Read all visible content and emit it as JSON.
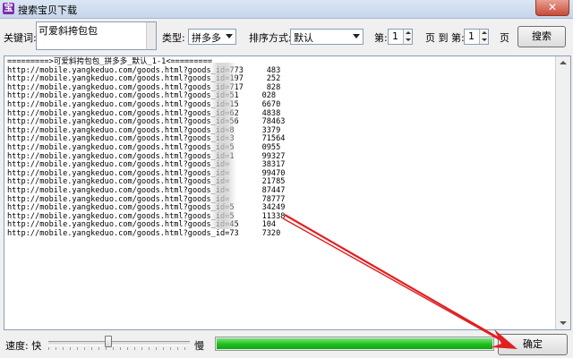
{
  "window": {
    "title": "搜索宝贝下载",
    "app_icon_glyph": "宝"
  },
  "search": {
    "keyword_label": "关键词:",
    "keyword_value": "可爱斜挎包包",
    "type_label": "类型:",
    "type_value": "拼多多",
    "sort_label": "排序方式:",
    "sort_value": "默认",
    "page_prefix": "第:",
    "page_from": "1",
    "page_middle": "页 到 第:",
    "page_to": "1",
    "page_suffix": "页",
    "search_button": "搜索"
  },
  "results": {
    "lines": [
      "=========>可爱斜挎包包_拼多多_默认_1-1<=========",
      "http://mobile.yangkeduo.com/goods.html?goods_id=773     483",
      "http://mobile.yangkeduo.com/goods.html?goods_id=197     252",
      "http://mobile.yangkeduo.com/goods.html?goods_id=717     828",
      "http://mobile.yangkeduo.com/goods.html?goods_id=51     028",
      "http://mobile.yangkeduo.com/goods.html?goods_id=15     6670",
      "http://mobile.yangkeduo.com/goods.html?goods_id=62     4838",
      "http://mobile.yangkeduo.com/goods.html?goods_id=56     78463",
      "http://mobile.yangkeduo.com/goods.html?goods_id=8      3379",
      "http://mobile.yangkeduo.com/goods.html?goods_id=3      71564",
      "http://mobile.yangkeduo.com/goods.html?goods_id=5      0955",
      "http://mobile.yangkeduo.com/goods.html?goods_id=1      99327",
      "http://mobile.yangkeduo.com/goods.html?goods_id=       38317",
      "http://mobile.yangkeduo.com/goods.html?goods_id=       99470",
      "http://mobile.yangkeduo.com/goods.html?goods_id=       21785",
      "http://mobile.yangkeduo.com/goods.html?goods_id=       87447",
      "http://mobile.yangkeduo.com/goods.html?goods_id=       78777",
      "http://mobile.yangkeduo.com/goods.html?goods_id=5      34249",
      "http://mobile.yangkeduo.com/goods.html?goods_id=5      11338",
      "http://mobile.yangkeduo.com/goods.html?goods_id=45     104",
      "http://mobile.yangkeduo.com/goods.html?goods_id=73     7320"
    ]
  },
  "footer": {
    "speed_label": "速度: 快",
    "slow_label": "慢",
    "speed_level": 0.42,
    "progress_fraction": 1.0,
    "ok_button": "确定"
  },
  "icons": {
    "close": "close-icon",
    "app": "app-icon"
  },
  "colors": {
    "progress": "#1fbf1f",
    "annotation_arrow": "#e02020",
    "close_button": "#c74a36"
  }
}
